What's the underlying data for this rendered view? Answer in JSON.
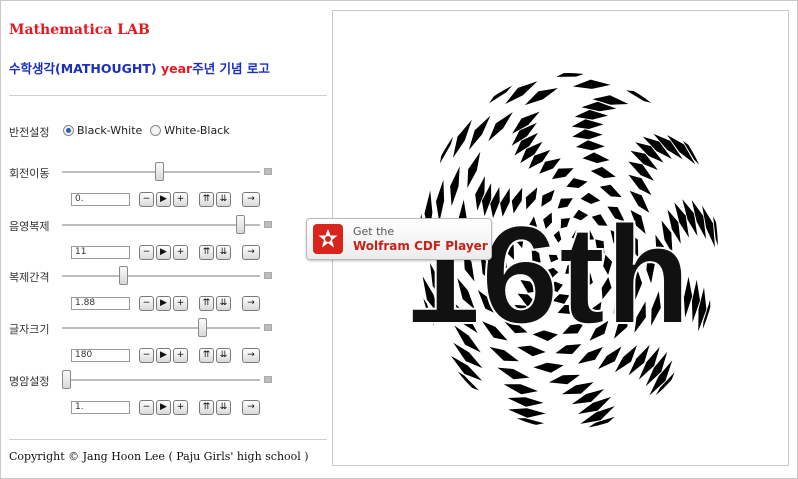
{
  "header": {
    "lab_title": "Mathematica LAB",
    "subtitle_prefix": "수학생각(MATHOUGHT)",
    "subtitle_year": "year",
    "subtitle_suffix": "주년 기념 로고"
  },
  "controls": {
    "invert": {
      "label": "반전설정",
      "options": [
        "Black-White",
        "White-Black"
      ],
      "selected": "Black-White"
    },
    "sliders": [
      {
        "label": "회전이동",
        "value": "0.",
        "fraction": 0.49
      },
      {
        "label": "음영복제",
        "value": "11",
        "fraction": 0.92
      },
      {
        "label": "복제간격",
        "value": "1.88",
        "fraction": 0.3
      },
      {
        "label": "글자크기",
        "value": "180",
        "fraction": 0.72
      },
      {
        "label": "명암설정",
        "value": "1.",
        "fraction": 0.0
      }
    ],
    "button_glyphs": {
      "minus": "−",
      "play": "▶",
      "plus": "+",
      "faster": "⇈",
      "slower": "⇊",
      "direction": "→"
    }
  },
  "footer": {
    "copyright": "Copyright © Jang Hoon Lee ( Paju Girls' high school )"
  },
  "graphic": {
    "logo_text": "16th"
  },
  "cdf_player": {
    "line1": "Get the",
    "line2": "Wolfram CDF Player",
    "icon": "wolfram-spikey-icon"
  },
  "colors": {
    "title_red": "#e8171f",
    "subtitle_blue": "#1a2fbf",
    "cdf_red": "#d8261e"
  }
}
